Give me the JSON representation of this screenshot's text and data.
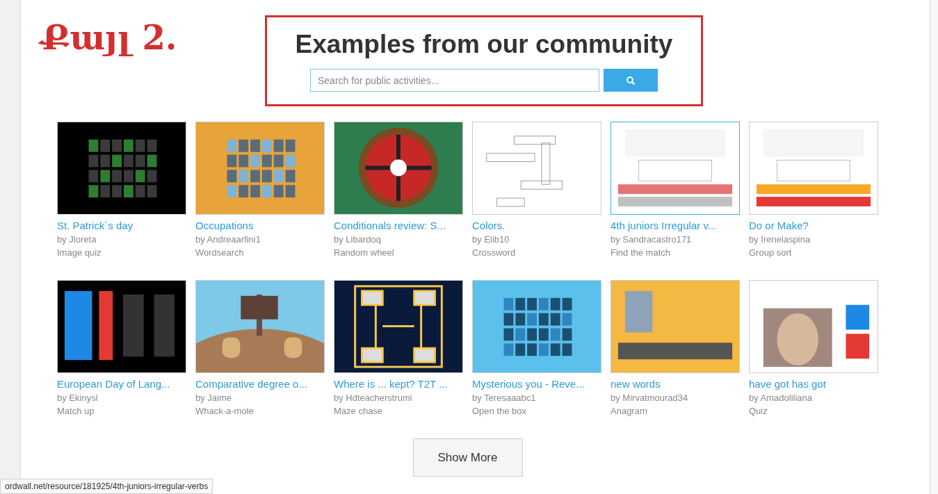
{
  "annotation": "Քայլ 2.",
  "section": {
    "title": "Examples from our community",
    "search": {
      "placeholder": "Search for public activities..."
    }
  },
  "activities": [
    {
      "title": "St. Patrick´s day",
      "author": "by Jloreta",
      "type": "Image quiz",
      "hovered": false
    },
    {
      "title": "Occupations",
      "author": "by Andreaarfini1",
      "type": "Wordsearch",
      "hovered": false
    },
    {
      "title": "Conditionals review: S...",
      "author": "by Libardoq",
      "type": "Random wheel",
      "hovered": false
    },
    {
      "title": "Colors.",
      "author": "by Elib10",
      "type": "Crossword",
      "hovered": false
    },
    {
      "title": "4th juniors Irregular v...",
      "author": "by Sandracastro171",
      "type": "Find the match",
      "hovered": true
    },
    {
      "title": "Do or Make?",
      "author": "by Irenelaspina",
      "type": "Group sort",
      "hovered": false
    },
    {
      "title": "European Day of Lang...",
      "author": "by Ekinysl",
      "type": "Match up",
      "hovered": false
    },
    {
      "title": "Comparative degree o...",
      "author": "by Jaime",
      "type": "Whack-a-mole",
      "hovered": false
    },
    {
      "title": "Where is ... kept? T2T ...",
      "author": "by Hdteacherstrumi",
      "type": "Maze chase",
      "hovered": false
    },
    {
      "title": "Mysterious you - Reve...",
      "author": "by Teresaaabc1",
      "type": "Open the box",
      "hovered": false
    },
    {
      "title": "new words",
      "author": "by Mirvatmourad34",
      "type": "Anagram",
      "hovered": false
    },
    {
      "title": "have got has got",
      "author": "by Amadoliliana",
      "type": "Quiz",
      "hovered": false
    }
  ],
  "show_more": "Show More",
  "status_bar": "ordwall.net/resource/181925/4th-juniors-irregular-verbs"
}
